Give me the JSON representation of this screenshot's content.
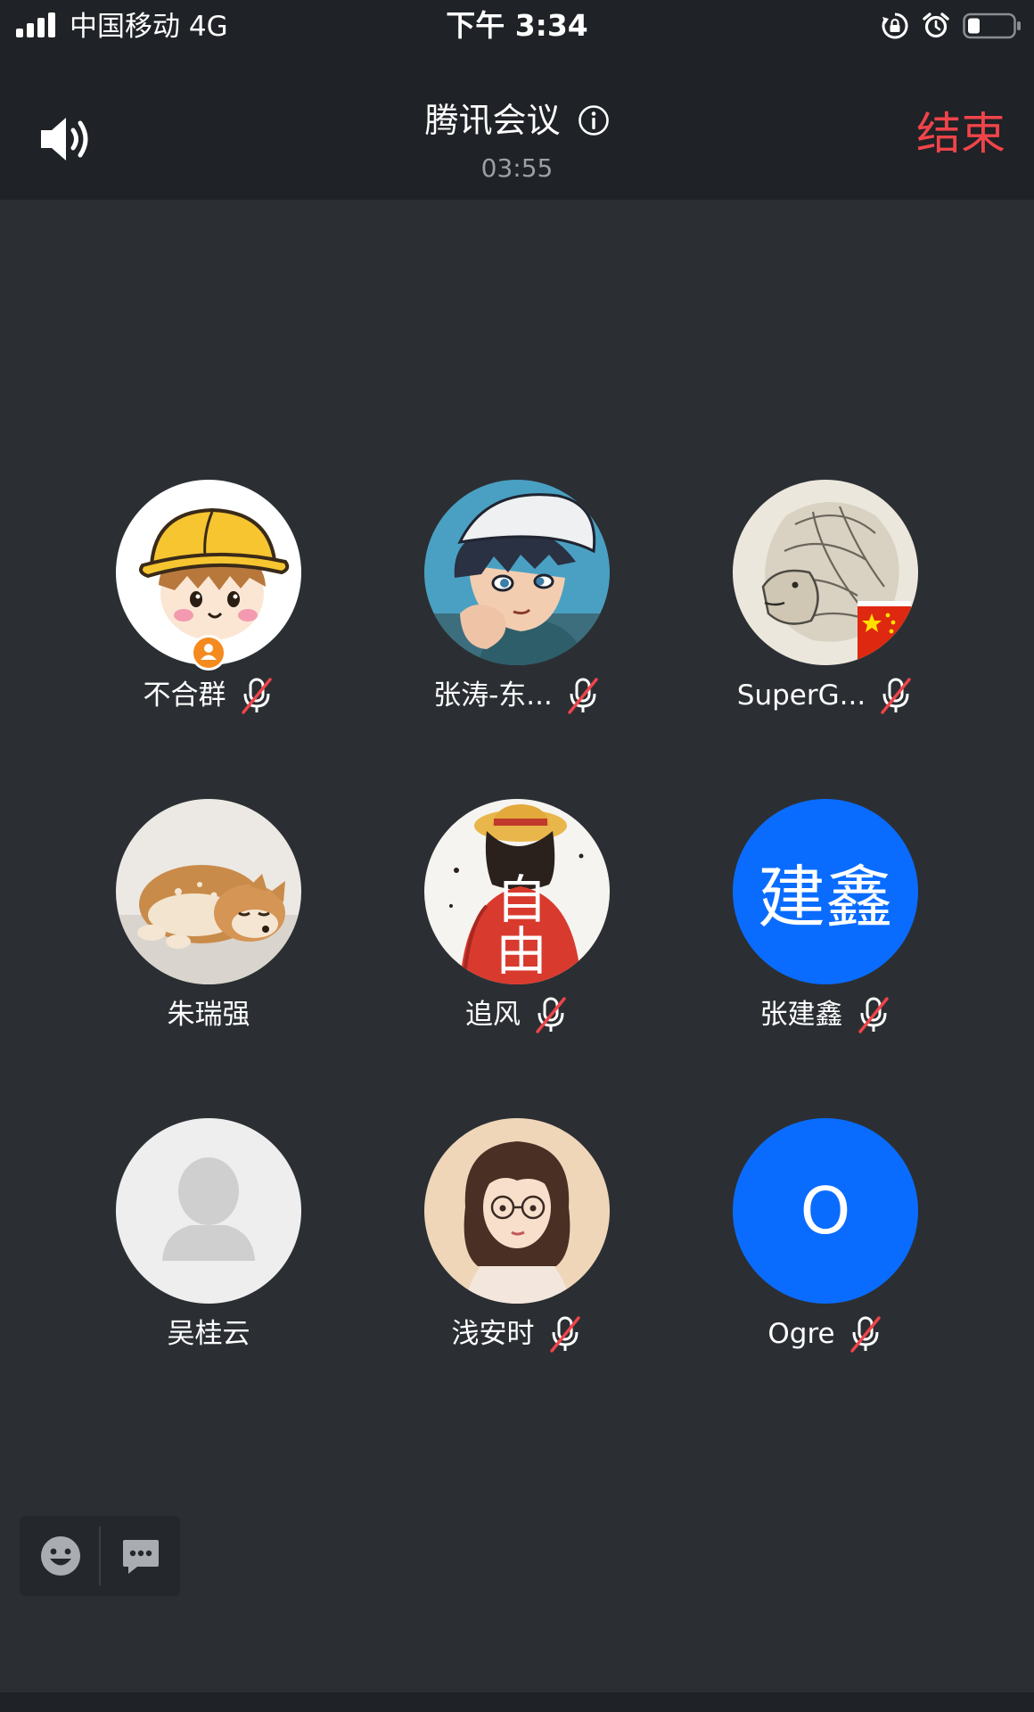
{
  "status_bar": {
    "carrier": "中国移动  4G",
    "time": "下午 3:34"
  },
  "header": {
    "title": "腾讯会议",
    "timer": "03:55",
    "end_label": "结束"
  },
  "participants": [
    {
      "name": "不合群",
      "muted": true,
      "host": true,
      "avatar": "cartoon-boy-yellow-hat"
    },
    {
      "name": "张涛-东...",
      "muted": true,
      "host": false,
      "avatar": "anime-boy-white-cap"
    },
    {
      "name": "SuperG...",
      "muted": true,
      "host": false,
      "avatar": "lion-sketch-china-flag"
    },
    {
      "name": "朱瑞强",
      "muted": false,
      "host": false,
      "avatar": "sleeping-shiba-dog"
    },
    {
      "name": "追风",
      "muted": true,
      "host": false,
      "avatar": "straw-hat-red-shirt",
      "avatar_text": "自由"
    },
    {
      "name": "张建鑫",
      "muted": true,
      "host": false,
      "avatar": "initials",
      "avatar_text": "建鑫"
    },
    {
      "name": "吴桂云",
      "muted": false,
      "host": false,
      "avatar": "default-person"
    },
    {
      "name": "浅安时",
      "muted": true,
      "host": false,
      "avatar": "illustrated-girl-glasses"
    },
    {
      "name": "Ogre",
      "muted": true,
      "host": false,
      "avatar": "initials",
      "avatar_text": "O"
    }
  ],
  "colors": {
    "background": "#2b2f33",
    "bar": "#1f2226",
    "end_red": "#f0444a",
    "initials_blue": "#0a6cff",
    "host_orange": "#f58a1f",
    "mute_slash": "#f0444a"
  },
  "toolbar": {
    "icons": [
      "emoji-icon",
      "chat-icon"
    ]
  }
}
